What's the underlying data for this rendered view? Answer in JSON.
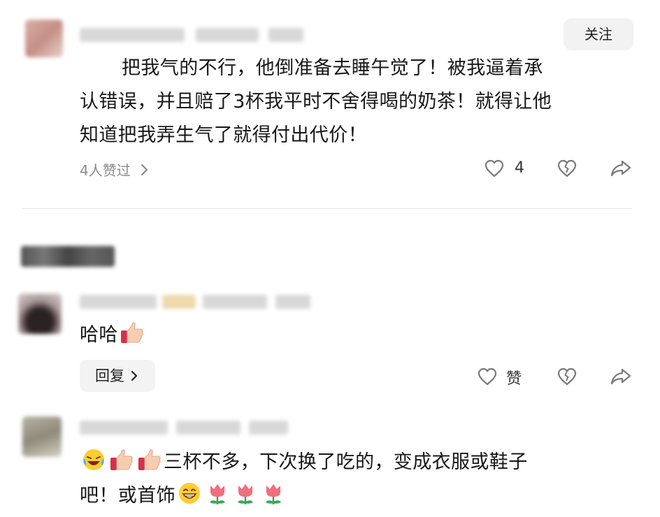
{
  "post": {
    "follow_label": "关注",
    "comment_lines": [
      "把我气的不行，他倒准备去睡午觉了！被我逼着承",
      "认错误，并且赔了3杯我平时不舍得喝的奶茶！就得让他",
      "知道把我弄生气了就得付出代价！"
    ],
    "likes_summary": "4人赞过",
    "like_count": "4"
  },
  "reply1": {
    "text": "哈哈",
    "reply_label": "回复",
    "like_label": "赞"
  },
  "reply2": {
    "line1": "三杯不多，下次换了吃的，变成衣服或鞋子",
    "line2": "吧！或首饰"
  },
  "colors": {
    "icon_gray": "#7a7a7a",
    "tulip_red": "#f06f7c",
    "leaf_green": "#3aa55a",
    "thumb_skin": "#f5c9a8"
  },
  "icons": [
    "heart-outline-icon",
    "broken-heart-icon",
    "share-arrow-icon",
    "chevron-right-icon",
    "thumbs-up-emoji",
    "laughing-emoji",
    "grinning-emoji",
    "tulip-emoji"
  ]
}
